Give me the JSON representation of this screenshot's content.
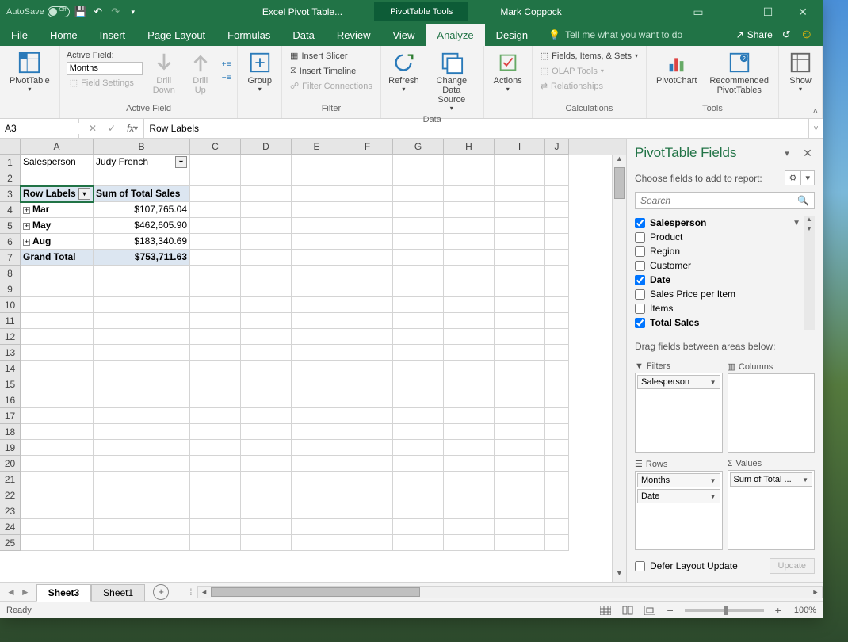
{
  "titlebar": {
    "autosave_label": "AutoSave",
    "autosave_state": "Off",
    "doc_title": "Excel Pivot Table...",
    "tools_title": "PivotTable Tools",
    "user_name": "Mark Coppock"
  },
  "tabs": {
    "file": "File",
    "home": "Home",
    "insert": "Insert",
    "page_layout": "Page Layout",
    "formulas": "Formulas",
    "data": "Data",
    "review": "Review",
    "view": "View",
    "analyze": "Analyze",
    "design": "Design",
    "tell_me": "Tell me what you want to do",
    "share": "Share"
  },
  "ribbon": {
    "pivottable": {
      "btn": "PivotTable",
      "group": ""
    },
    "active_field": {
      "label": "Active Field:",
      "value": "Months",
      "field_settings": "Field Settings",
      "drill_down": "Drill\nDown",
      "drill_up": "Drill\nUp",
      "group_label": "Active Field"
    },
    "group": {
      "btn": "Group",
      "group_label": ""
    },
    "filter": {
      "slicer": "Insert Slicer",
      "timeline": "Insert Timeline",
      "connections": "Filter Connections",
      "group_label": "Filter"
    },
    "data": {
      "refresh": "Refresh",
      "change": "Change Data\nSource",
      "group_label": "Data"
    },
    "actions": {
      "btn": "Actions",
      "group_label": ""
    },
    "calculations": {
      "fields": "Fields, Items, & Sets",
      "olap": "OLAP Tools",
      "relationships": "Relationships",
      "group_label": "Calculations"
    },
    "tools": {
      "pivotchart": "PivotChart",
      "recommended": "Recommended\nPivotTables",
      "group_label": "Tools"
    },
    "show": {
      "btn": "Show",
      "group_label": ""
    }
  },
  "formula_bar": {
    "name_box": "A3",
    "formula": "Row Labels"
  },
  "columns": [
    "A",
    "B",
    "C",
    "D",
    "E",
    "F",
    "G",
    "H",
    "I",
    "J"
  ],
  "sheet": {
    "r1_a": "Salesperson",
    "r1_b": "Judy French",
    "r3_a": "Row Labels",
    "r3_b": "Sum of Total Sales",
    "rows": [
      {
        "label": "Mar",
        "value": "$107,765.04"
      },
      {
        "label": "May",
        "value": "$462,605.90"
      },
      {
        "label": "Aug",
        "value": "$183,340.69"
      }
    ],
    "total_label": "Grand Total",
    "total_value": "$753,711.63"
  },
  "pivot_pane": {
    "title": "PivotTable Fields",
    "subtitle": "Choose fields to add to report:",
    "search_placeholder": "Search",
    "fields": [
      {
        "name": "Salesperson",
        "checked": true,
        "filter": true
      },
      {
        "name": "Product",
        "checked": false
      },
      {
        "name": "Region",
        "checked": false
      },
      {
        "name": "Customer",
        "checked": false
      },
      {
        "name": "Date",
        "checked": true
      },
      {
        "name": "Sales Price per Item",
        "checked": false
      },
      {
        "name": "Items",
        "checked": false
      },
      {
        "name": "Total Sales",
        "checked": true
      }
    ],
    "areas_label": "Drag fields between areas below:",
    "filters_label": "Filters",
    "columns_label": "Columns",
    "rows_label": "Rows",
    "values_label": "Values",
    "filter_items": [
      "Salesperson"
    ],
    "row_items": [
      "Months",
      "Date"
    ],
    "value_items": [
      "Sum of Total ..."
    ],
    "defer_label": "Defer Layout Update",
    "update_btn": "Update"
  },
  "sheet_tabs": {
    "active": "Sheet3",
    "other": "Sheet1"
  },
  "status": {
    "ready": "Ready",
    "zoom": "100%"
  }
}
